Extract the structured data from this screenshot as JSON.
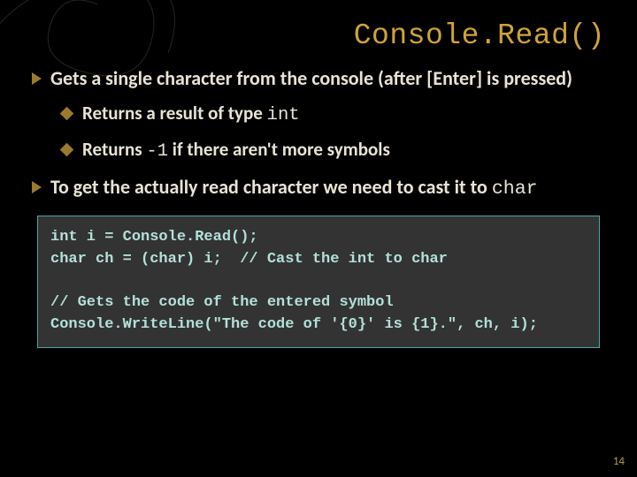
{
  "title": "Console.Read()",
  "bullets": {
    "b1a_pre": "Gets a single character from the console (after [",
    "b1a_key": "Enter",
    "b1a_post": "] is pressed)",
    "b2a_pre": "Returns a result of type ",
    "b2a_code": "int",
    "b2b_pre": "Returns ",
    "b2b_code": "-1",
    "b2b_post": " if there aren't more symbols",
    "b1b_pre": "To get the actually read character we need to cast it to ",
    "b1b_code": "char"
  },
  "code": "int i = Console.Read();\nchar ch = (char) i;  // Cast the int to char\n\n// Gets the code of the entered symbol\nConsole.WriteLine(\"The code of '{0}' is {1}.\", ch, i);",
  "page_number": "14"
}
